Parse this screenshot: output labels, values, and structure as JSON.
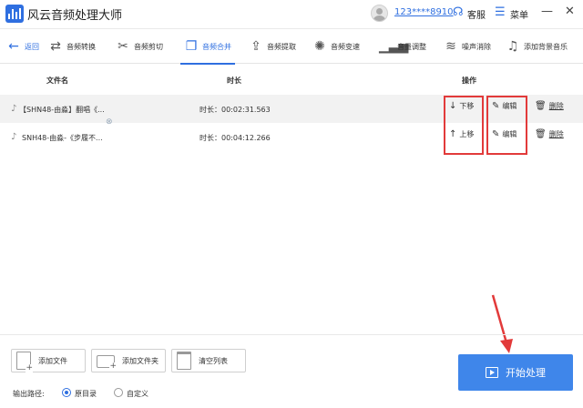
{
  "app": {
    "title": "风云音频处理大师"
  },
  "titlebar": {
    "user_id": "123****8910",
    "service_label": "客服",
    "menu_label": "菜单",
    "minimize": "—",
    "close": "✕"
  },
  "toolbar": {
    "back_label": "返回",
    "tools": [
      {
        "label": "音频转换"
      },
      {
        "label": "音频剪切"
      },
      {
        "label": "音频合并"
      },
      {
        "label": "音频提取"
      },
      {
        "label": "音频变速"
      },
      {
        "label": "音量调整"
      },
      {
        "label": "噪声消除"
      },
      {
        "label": "添加背景音乐"
      }
    ],
    "active_tool": "音频合并"
  },
  "table": {
    "headers": {
      "filename": "文件名",
      "duration": "时长",
      "actions": "操作"
    },
    "rows": [
      {
        "name": "【SHN48-由淼】翻唱《...",
        "duration": "时长：00:02:31.563",
        "move_label": "下移",
        "edit_label": "编辑",
        "delete_label": "删除"
      },
      {
        "name": "SNH48-由淼-《步履不...",
        "duration": "时长：00:04:12.266",
        "move_label": "上移",
        "edit_label": "编辑",
        "delete_label": "删除"
      }
    ]
  },
  "bottom": {
    "add_file": "添加文件",
    "add_folder": "添加文件夹",
    "clear_list": "清空列表",
    "output_path_label": "输出路径:",
    "option_original": "原目录",
    "option_custom": "自定义",
    "selected_option": "原目录",
    "start_label": "开始处理"
  },
  "colors": {
    "accent": "#2f6fe0",
    "start_button": "#3f86ea",
    "annotation_red": "#e23a3a",
    "row_alt": "#f2f2f2"
  }
}
